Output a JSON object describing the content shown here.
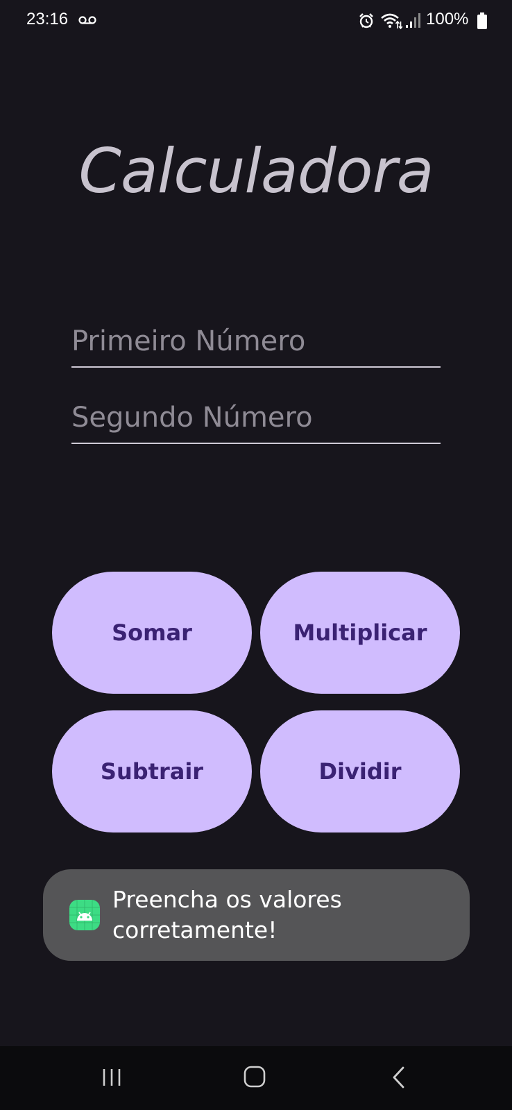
{
  "status_bar": {
    "time": "23:16",
    "battery_percent": "100%",
    "icons": [
      "voicemail-icon",
      "alarm-icon",
      "wifi-icon",
      "signal-icon",
      "battery-icon"
    ]
  },
  "app": {
    "title": "Calculadora"
  },
  "fields": {
    "first": {
      "value": "",
      "placeholder": "Primeiro Número"
    },
    "second": {
      "value": "",
      "placeholder": "Segundo Número"
    }
  },
  "buttons": {
    "add": "Somar",
    "multiply": "Multiplicar",
    "subtract": "Subtrair",
    "divide": "Dividir"
  },
  "toast": {
    "message": "Preencha os valores\ncorretamente!",
    "icon": "android-app-icon"
  },
  "navigation": {
    "icons": [
      "recents-icon",
      "home-icon",
      "back-icon"
    ]
  },
  "colors": {
    "background": "#17151c",
    "button_fill": "#d0bcfe",
    "button_text": "#3a2273",
    "title": "#c8c3ce",
    "toast_background": "#555557",
    "nav_bar": "#0b0b0d"
  }
}
